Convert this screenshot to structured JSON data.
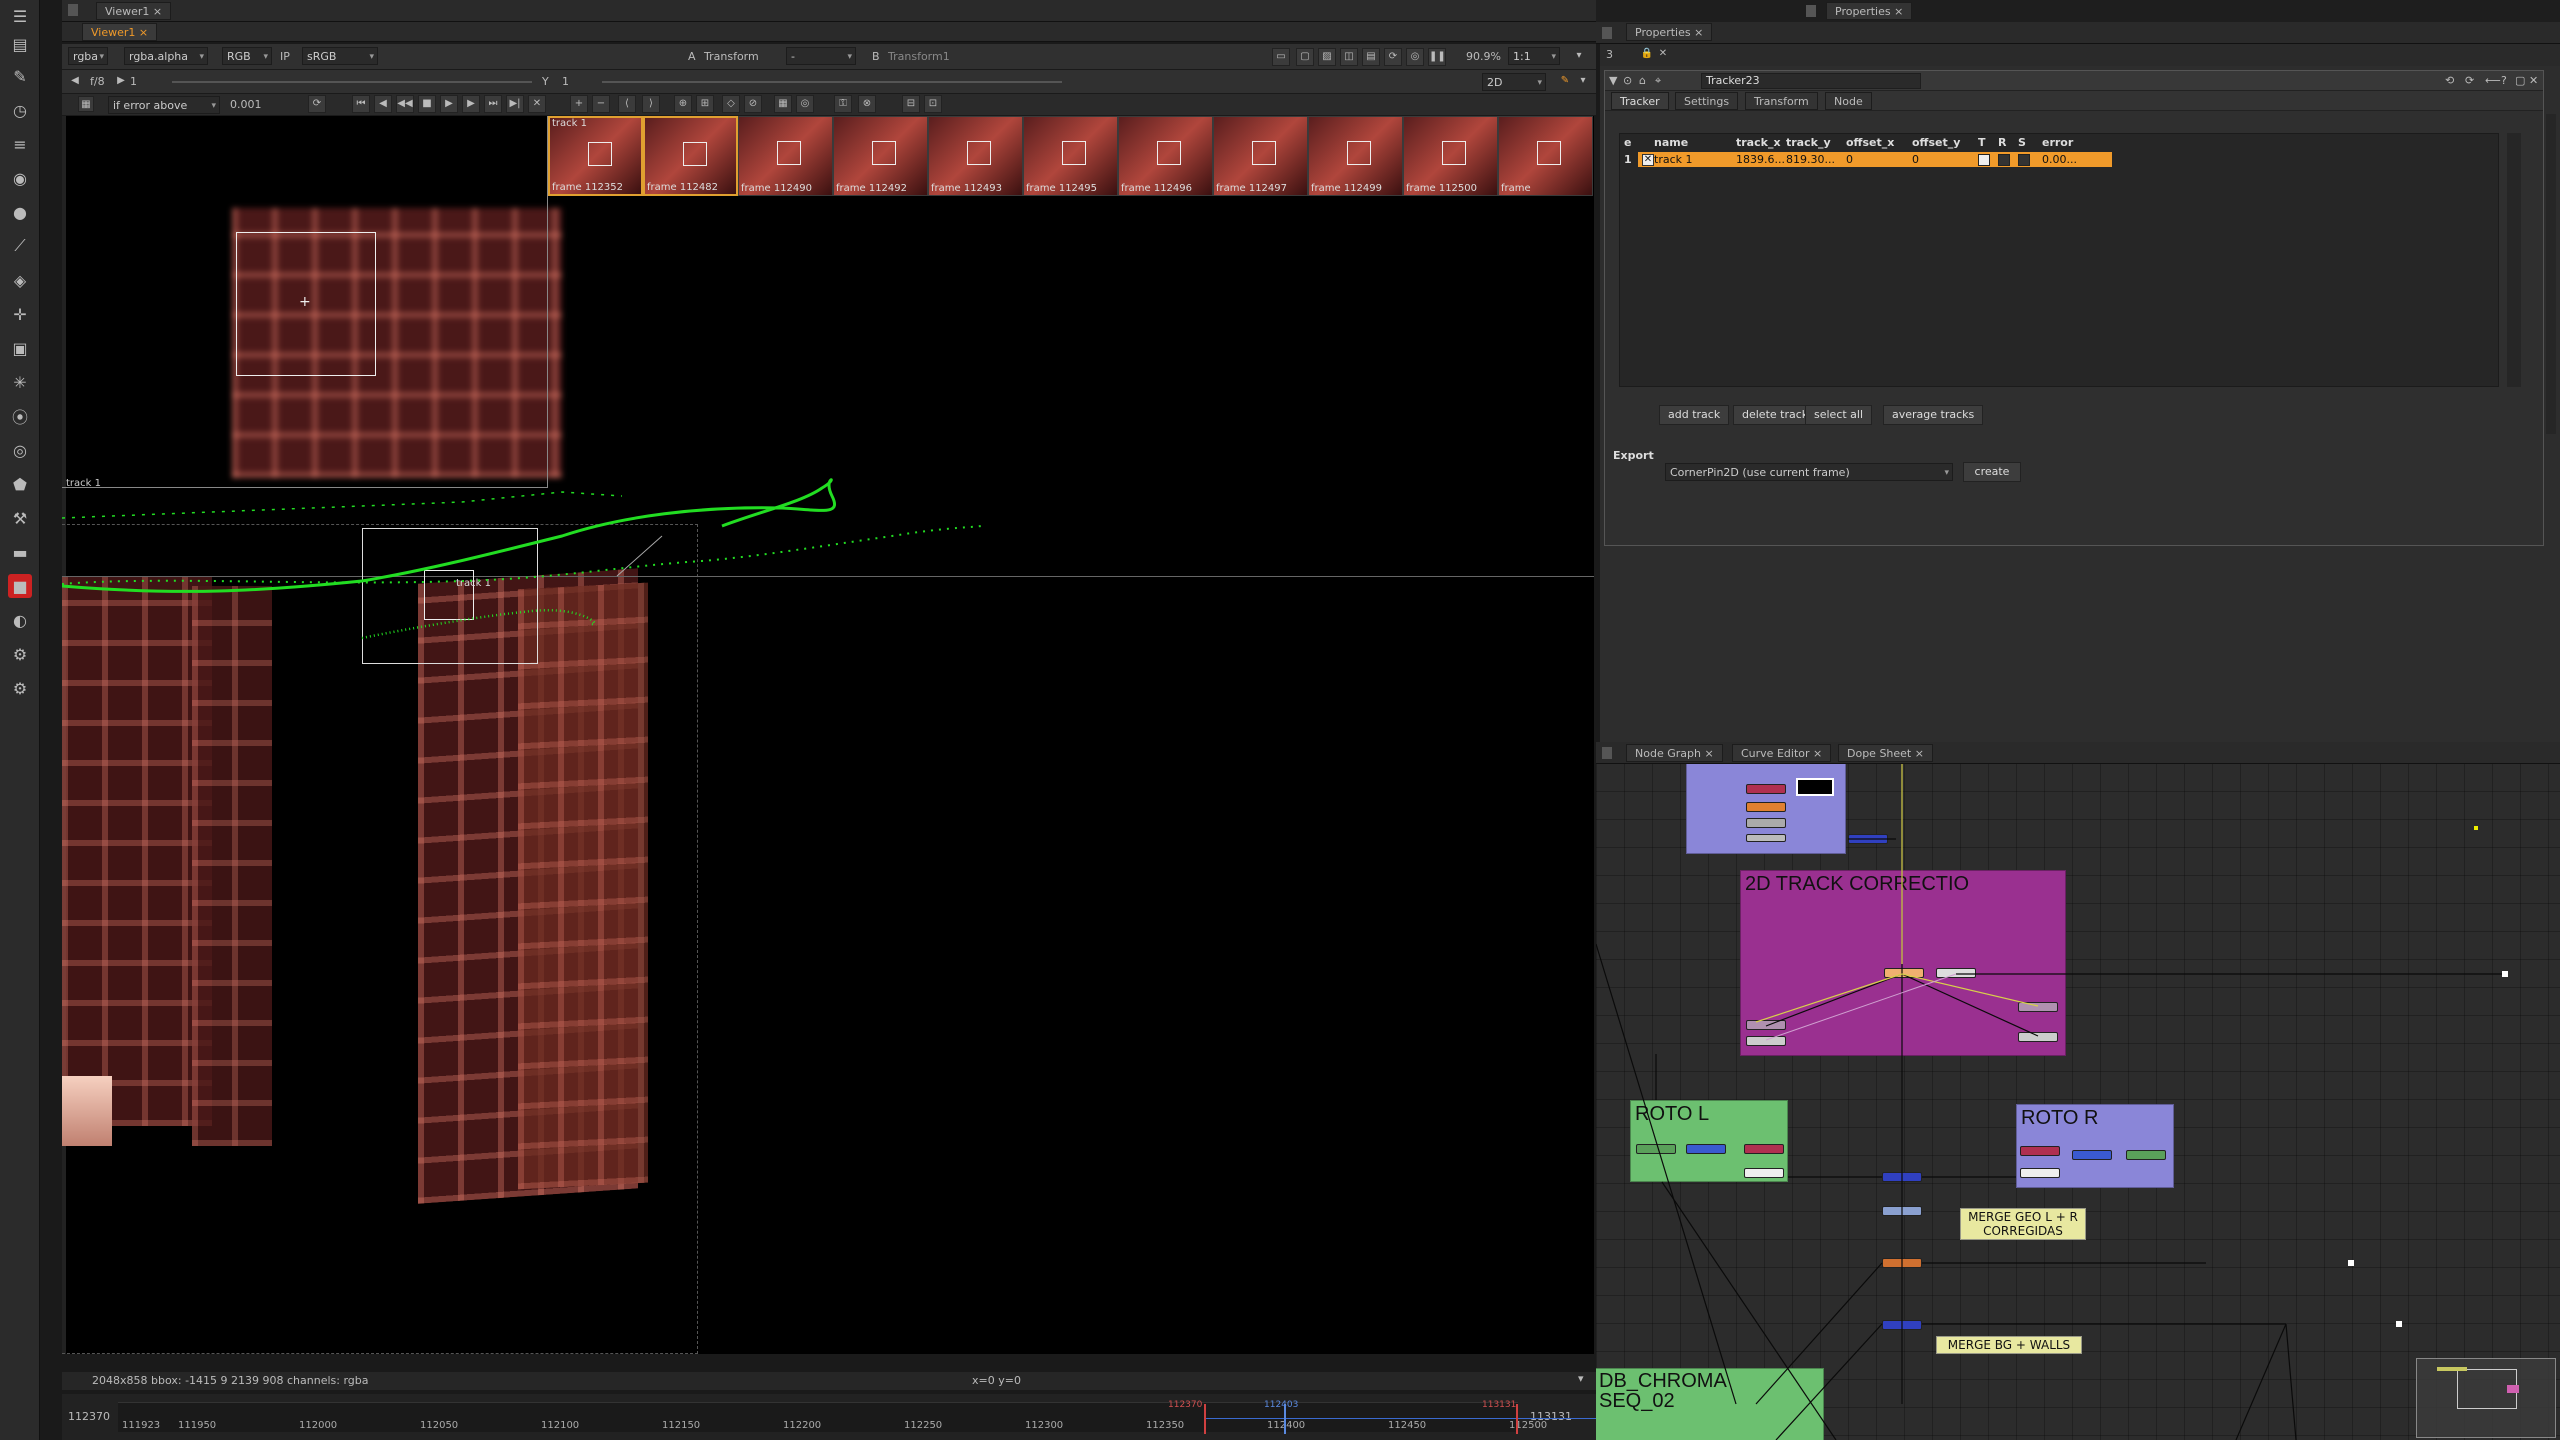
{
  "colors": {
    "accent": "#f09a2a",
    "track_green": "#22dd22",
    "row_highlight": "#f09a2a"
  },
  "viewer": {
    "tab_label": "Viewer1",
    "channels": "rgba",
    "alpha": "rgba.alpha",
    "display": "RGB",
    "ip": "IP",
    "lut": "sRGB",
    "input_a_label": "A",
    "input_a": "Transform",
    "input_b_value": "-",
    "input_b_label": "B",
    "input_b": "Transform1",
    "zoom": "90.9%",
    "ratio": "1:1",
    "mode2d": "2D",
    "fstop": "f/8",
    "frame_step": "1",
    "y_label": "Y",
    "y_value": "1",
    "error_mode": "if error above",
    "error_value": "0.001",
    "track_label_top": "track 1",
    "track_label_left": "track 1",
    "track_label_center": "track 1",
    "status_info": "2048x858  bbox: -1415 9 2139 908 channels: rgba",
    "coords": "x=0 y=0",
    "keyframes": [
      {
        "caption": "frame 112352",
        "selected": true
      },
      {
        "caption": "frame 112482",
        "selected": true
      },
      {
        "caption": "frame 112490",
        "selected": false
      },
      {
        "caption": "frame 112492",
        "selected": false
      },
      {
        "caption": "frame 112493",
        "selected": false
      },
      {
        "caption": "frame 112495",
        "selected": false
      },
      {
        "caption": "frame 112496",
        "selected": false
      },
      {
        "caption": "frame 112497",
        "selected": false
      },
      {
        "caption": "frame 112499",
        "selected": false
      },
      {
        "caption": "frame 112500",
        "selected": false
      },
      {
        "caption": "frame",
        "selected": false
      }
    ]
  },
  "timeline": {
    "start": "112370",
    "end": "113131",
    "ticks": [
      "111923",
      "111950",
      "112000",
      "112050",
      "112100",
      "112150",
      "112200",
      "112250",
      "112300",
      "112350",
      "112400",
      "112450",
      "112500"
    ],
    "marker_in": "112370",
    "marker_current": "112403",
    "marker_out": "113131"
  },
  "properties": {
    "tab_label": "Properties",
    "tab_label_right": "Properties",
    "count": "3",
    "node_name": "Tracker23",
    "tabs": [
      "Tracker",
      "Settings",
      "Transform",
      "Node"
    ],
    "columns": [
      "e",
      "name",
      "track_x",
      "track_y",
      "offset_x",
      "offset_y",
      "T",
      "R",
      "S",
      "error"
    ],
    "rows": [
      {
        "index": "1",
        "name": "track 1",
        "track_x": "1839.6...",
        "track_y": "819.30...",
        "offset_x": "0",
        "offset_y": "0",
        "error": "0.00..."
      }
    ],
    "buttons": [
      "add track",
      "delete tracks",
      "select all",
      "average tracks"
    ],
    "export_label": "Export",
    "export_option": "CornerPin2D (use current frame)",
    "create_button": "create"
  },
  "nodegraph": {
    "tabs": [
      "Node Graph",
      "Curve Editor",
      "Dope Sheet"
    ],
    "backdrops": {
      "track_correction": "2D TRACK CORRECTIO",
      "roto_l": "ROTO L",
      "roto_r": "ROTO R",
      "chroma": "DB_CHROMA\nSEQ_02"
    },
    "stickies": {
      "merge_geo": "MERGE GEO L + R\nCORREGIDAS",
      "merge_bg": "MERGE BG + WALLS"
    }
  },
  "icons": [
    "menu-icon",
    "read-icon",
    "draw-icon",
    "time-icon",
    "channel-icon",
    "color-icon",
    "filter-icon",
    "keyer-icon",
    "merge-icon",
    "transform-icon",
    "3d-icon",
    "particles-icon",
    "toolsets-icon",
    "other-icon",
    "furnace-icon",
    "deep-icon",
    "cara-icon",
    "nuke-icon",
    "plugin-icon"
  ]
}
